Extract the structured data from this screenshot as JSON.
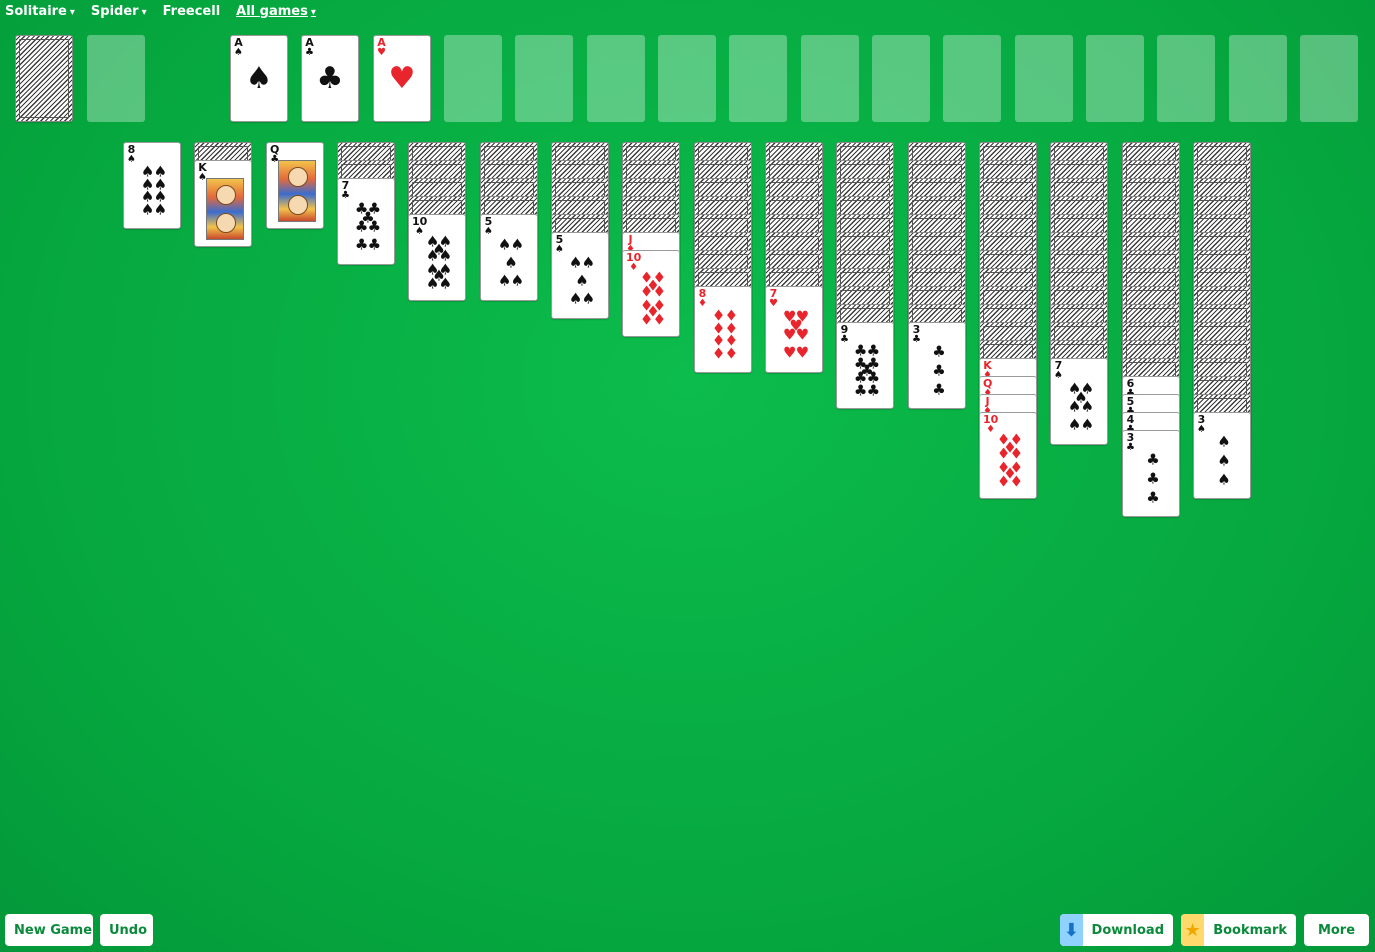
{
  "nav": [
    {
      "label": "Solitaire",
      "caret": "▾",
      "underline": false
    },
    {
      "label": "Spider",
      "caret": "▾",
      "underline": false
    },
    {
      "label": "Freecell",
      "caret": "",
      "underline": false
    },
    {
      "label": "All games",
      "caret": "▾",
      "underline": true
    }
  ],
  "stock": {
    "has_cards": true
  },
  "foundations": [
    {
      "rank": "A",
      "suit": "♠"
    },
    {
      "rank": "A",
      "suit": "♣"
    },
    {
      "rank": "A",
      "suit": "♥"
    },
    null,
    null,
    null,
    null,
    null,
    null,
    null,
    null,
    null,
    null,
    null,
    null,
    null
  ],
  "tableau": [
    {
      "hidden": 0,
      "cards": [
        {
          "rank": "8",
          "suit": "♠"
        }
      ]
    },
    {
      "hidden": 1,
      "cards": [
        {
          "rank": "K",
          "suit": "♠"
        }
      ]
    },
    {
      "hidden": 0,
      "cards": [
        {
          "rank": "Q",
          "suit": "♣"
        }
      ]
    },
    {
      "hidden": 2,
      "cards": [
        {
          "rank": "7",
          "suit": "♣"
        }
      ]
    },
    {
      "hidden": 4,
      "cards": [
        {
          "rank": "10",
          "suit": "♠"
        }
      ]
    },
    {
      "hidden": 4,
      "cards": [
        {
          "rank": "5",
          "suit": "♠"
        }
      ]
    },
    {
      "hidden": 5,
      "cards": [
        {
          "rank": "5",
          "suit": "♠"
        }
      ]
    },
    {
      "hidden": 5,
      "cards": [
        {
          "rank": "J",
          "suit": "♦"
        },
        {
          "rank": "10",
          "suit": "♦"
        }
      ]
    },
    {
      "hidden": 8,
      "cards": [
        {
          "rank": "8",
          "suit": "♦"
        }
      ]
    },
    {
      "hidden": 8,
      "cards": [
        {
          "rank": "7",
          "suit": "♥"
        }
      ]
    },
    {
      "hidden": 10,
      "cards": [
        {
          "rank": "9",
          "suit": "♣"
        }
      ]
    },
    {
      "hidden": 10,
      "cards": [
        {
          "rank": "3",
          "suit": "♣"
        }
      ]
    },
    {
      "hidden": 12,
      "cards": [
        {
          "rank": "K",
          "suit": "♦"
        },
        {
          "rank": "Q",
          "suit": "♦"
        },
        {
          "rank": "J",
          "suit": "♦"
        },
        {
          "rank": "10",
          "suit": "♦"
        }
      ]
    },
    {
      "hidden": 12,
      "cards": [
        {
          "rank": "7",
          "suit": "♠"
        }
      ]
    },
    {
      "hidden": 13,
      "cards": [
        {
          "rank": "6",
          "suit": "♣"
        },
        {
          "rank": "5",
          "suit": "♣"
        },
        {
          "rank": "4",
          "suit": "♣"
        },
        {
          "rank": "3",
          "suit": "♣"
        }
      ]
    },
    {
      "hidden": 15,
      "cards": [
        {
          "rank": "3",
          "suit": "♠"
        }
      ]
    }
  ],
  "buttons": {
    "new_game": "New Game",
    "undo": "Undo",
    "download": "Download",
    "bookmark": "Bookmark",
    "more": "More"
  },
  "icons": {
    "download": "download-arrow-icon",
    "bookmark": "star-icon"
  },
  "colors": {
    "felt": "#05a63e",
    "button_text": "#0a8a3a",
    "red_suit": "#e8252c",
    "download_icon_bg": "#8fd2ff",
    "bookmark_icon_bg": "#ffd96b"
  }
}
